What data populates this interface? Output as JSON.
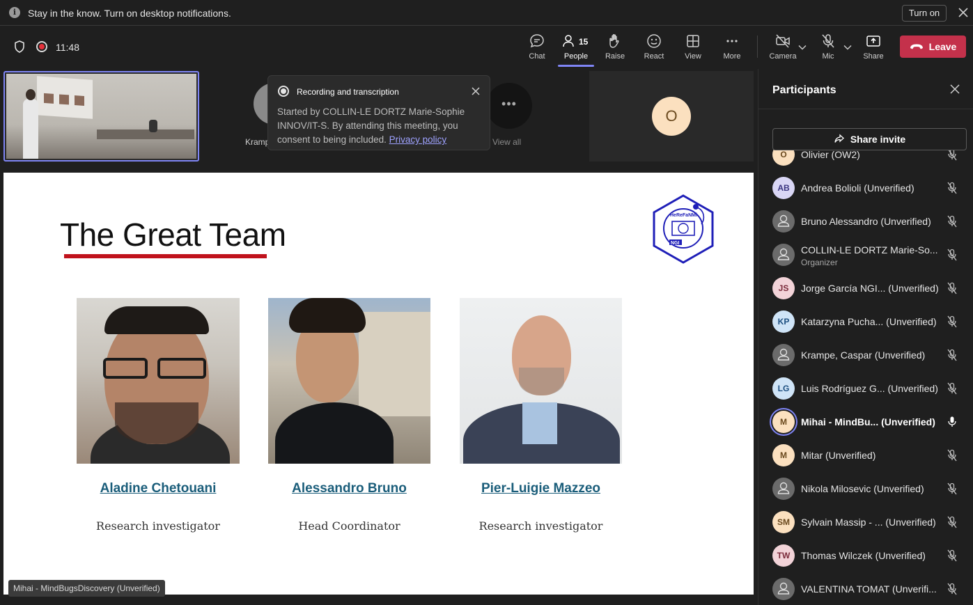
{
  "notification": {
    "message": "Stay in the know. Turn on desktop notifications.",
    "turn_on_label": "Turn on"
  },
  "toolbar": {
    "timer": "11:48",
    "chat_label": "Chat",
    "people_label": "People",
    "people_count": "15",
    "raise_label": "Raise",
    "react_label": "React",
    "view_label": "View",
    "more_label": "More",
    "camera_label": "Camera",
    "mic_label": "Mic",
    "share_label": "Share",
    "leave_label": "Leave"
  },
  "strip": {
    "krampe_name": "Kramp",
    "view_all_label": "View all",
    "o_initial": "O"
  },
  "recording_popup": {
    "title": "Recording and transcription",
    "body": "Started by COLLIN-LE DORTZ Marie-Sophie INNOV/IT-S. By attending this meeting, you consent to being included.",
    "link": "Privacy policy"
  },
  "slide": {
    "title": "The Great Team",
    "logo_text": "HeReFaNMi",
    "logo_sub": "NGI",
    "people": [
      {
        "name": "Aladine Chetouani ",
        "role": "Research investigator"
      },
      {
        "name": "Alessandro Bruno ",
        "role": "Head Coordinator"
      },
      {
        "name": "Pier-Luigie Mazzeo ",
        "role": "Research investigator"
      }
    ]
  },
  "speaker_tag": "Mihai - MindBugsDiscovery (Unverified)",
  "panel": {
    "title": "Participants",
    "share_invite_label": "Share invite",
    "participants": [
      {
        "initials": "O",
        "name": "Olivier (OW2)",
        "sub": "",
        "avatar_bg": "#fbe0bf",
        "avatar_fg": "#6b4a1f",
        "muted": true
      },
      {
        "initials": "AB",
        "name": "Andrea Bolioli (Unverified)",
        "sub": "",
        "avatar_bg": "#d9d6f5",
        "avatar_fg": "#3a3580",
        "muted": true
      },
      {
        "initials": "",
        "name": "Bruno Alessandro (Unverified)",
        "sub": "",
        "avatar_bg": "#6b6b6b",
        "avatar_fg": "#ffffff",
        "muted": true
      },
      {
        "initials": "",
        "name": "COLLIN-LE DORTZ Marie-So...",
        "sub": "Organizer",
        "avatar_bg": "#6b6b6b",
        "avatar_fg": "#ffffff",
        "muted": true
      },
      {
        "initials": "JS",
        "name": "Jorge García NGI...  (Unverified)",
        "sub": "",
        "avatar_bg": "#f2d3d8",
        "avatar_fg": "#7a2a3a",
        "muted": true
      },
      {
        "initials": "KP",
        "name": "Katarzyna Pucha...  (Unverified)",
        "sub": "",
        "avatar_bg": "#cfe4f7",
        "avatar_fg": "#1d4f80",
        "muted": true
      },
      {
        "initials": "",
        "name": "Krampe, Caspar (Unverified)",
        "sub": "",
        "avatar_bg": "#6b6b6b",
        "avatar_fg": "#ffffff",
        "muted": true
      },
      {
        "initials": "LG",
        "name": "Luis Rodríguez G...  (Unverified)",
        "sub": "",
        "avatar_bg": "#cfe4f7",
        "avatar_fg": "#1d4f80",
        "muted": true
      },
      {
        "initials": "M",
        "name": "Mihai - MindBu...   (Unverified)",
        "sub": "",
        "avatar_bg": "#fbe0bf",
        "avatar_fg": "#6b4a1f",
        "muted": false
      },
      {
        "initials": "M",
        "name": "Mitar (Unverified)",
        "sub": "",
        "avatar_bg": "#fbe0bf",
        "avatar_fg": "#6b4a1f",
        "muted": true
      },
      {
        "initials": "",
        "name": "Nikola Milosevic (Unverified)",
        "sub": "",
        "avatar_bg": "#6b6b6b",
        "avatar_fg": "#ffffff",
        "muted": true
      },
      {
        "initials": "SM",
        "name": "Sylvain Massip - ...  (Unverified)",
        "sub": "",
        "avatar_bg": "#fbe0bf",
        "avatar_fg": "#6b4a1f",
        "muted": true
      },
      {
        "initials": "TW",
        "name": "Thomas Wilczek (Unverified)",
        "sub": "",
        "avatar_bg": "#f2d3d8",
        "avatar_fg": "#7a2a3a",
        "muted": true
      },
      {
        "initials": "",
        "name": "VALENTINA TOMAT (Unverifi...",
        "sub": "",
        "avatar_bg": "#6b6b6b",
        "avatar_fg": "#ffffff",
        "muted": true
      }
    ]
  },
  "colors": {
    "accent": "#7f85f5",
    "leave": "#c4314b",
    "title_rule": "#c0121c",
    "name_link": "#1a5d7a"
  }
}
